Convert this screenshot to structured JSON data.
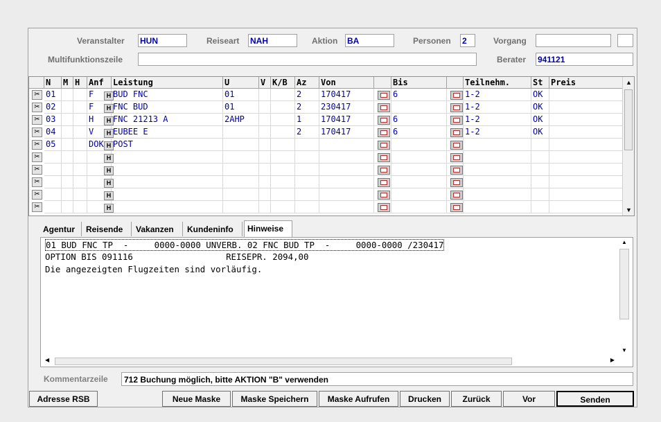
{
  "header": {
    "veranstalter_label": "Veranstalter",
    "veranstalter_value": "HUN",
    "reiseart_label": "Reiseart",
    "reiseart_value": "NAH",
    "aktion_label": "Aktion",
    "aktion_value": "BA",
    "personen_label": "Personen",
    "personen_value": "2",
    "vorgang_label": "Vorgang",
    "vorgang_value": "",
    "multi_label": "Multifunktionszeile",
    "multi_value": "",
    "berater_label": "Berater",
    "berater_value": "941121"
  },
  "grid": {
    "columns": [
      "N",
      "M",
      "H",
      "Anf",
      "Leistung",
      "U",
      "V",
      "K/B",
      "Az",
      "Von",
      "",
      "Bis",
      "",
      "Teilnehm.",
      "St",
      "Preis"
    ],
    "rows": [
      {
        "n": "01",
        "anf": "F",
        "leistung": "BUD FNC",
        "u": "01",
        "az": "2",
        "von": "170417",
        "bis": "6",
        "teilnehm": "1-2",
        "st": "OK"
      },
      {
        "n": "02",
        "anf": "F",
        "leistung": "FNC BUD",
        "u": "01",
        "az": "2",
        "von": "230417",
        "bis": "",
        "teilnehm": "1-2",
        "st": "OK"
      },
      {
        "n": "03",
        "anf": "H",
        "leistung": "FNC 21213 A",
        "u": "2AHP",
        "az": "1",
        "von": "170417",
        "bis": "6",
        "teilnehm": "1-2",
        "st": "OK"
      },
      {
        "n": "04",
        "anf": "V",
        "leistung": "EUBEE E",
        "u": "",
        "az": "2",
        "von": "170417",
        "bis": "6",
        "teilnehm": "1-2",
        "st": "OK"
      },
      {
        "n": "05",
        "anf": "DOK",
        "leistung": "POST",
        "u": "",
        "az": "",
        "von": "",
        "bis": "",
        "teilnehm": "",
        "st": ""
      },
      {
        "n": "",
        "anf": "",
        "leistung": "",
        "u": "",
        "az": "",
        "von": "",
        "bis": "",
        "teilnehm": "",
        "st": ""
      },
      {
        "n": "",
        "anf": "",
        "leistung": "",
        "u": "",
        "az": "",
        "von": "",
        "bis": "",
        "teilnehm": "",
        "st": ""
      },
      {
        "n": "",
        "anf": "",
        "leistung": "",
        "u": "",
        "az": "",
        "von": "",
        "bis": "",
        "teilnehm": "",
        "st": ""
      },
      {
        "n": "",
        "anf": "",
        "leistung": "",
        "u": "",
        "az": "",
        "von": "",
        "bis": "",
        "teilnehm": "",
        "st": ""
      },
      {
        "n": "",
        "anf": "",
        "leistung": "",
        "u": "",
        "az": "",
        "von": "",
        "bis": "",
        "teilnehm": "",
        "st": ""
      }
    ],
    "h_label": "H"
  },
  "tabs": [
    {
      "label": "Agentur"
    },
    {
      "label": "Reisende"
    },
    {
      "label": "Vakanzen"
    },
    {
      "label": "Kundeninfo"
    },
    {
      "label": "Hinweise"
    }
  ],
  "hinweise": {
    "lines": [
      "01 BUD FNC TP  -     0000-0000 UNVERB. 02 FNC BUD TP  -     0000-0000 /230417",
      "OPTION BIS 091116                  REISEPR. 2094,00",
      "Die angezeigten Flugzeiten sind vorläufig."
    ]
  },
  "kommentar": {
    "label": "Kommentarzeile",
    "value": "712 Buchung möglich, bitte AKTION \"B\" verwenden"
  },
  "buttons": {
    "adresse": "Adresse RSB",
    "neue_maske": "Neue Maske",
    "maske_speichern": "Maske Speichern",
    "maske_aufrufen": "Maske Aufrufen",
    "drucken": "Drucken",
    "zurueck": "Zurück",
    "vor": "Vor",
    "senden": "Senden"
  },
  "colors": {
    "value_text": "#0000b0",
    "label_text": "#707070",
    "background": "#f0f0f0"
  }
}
